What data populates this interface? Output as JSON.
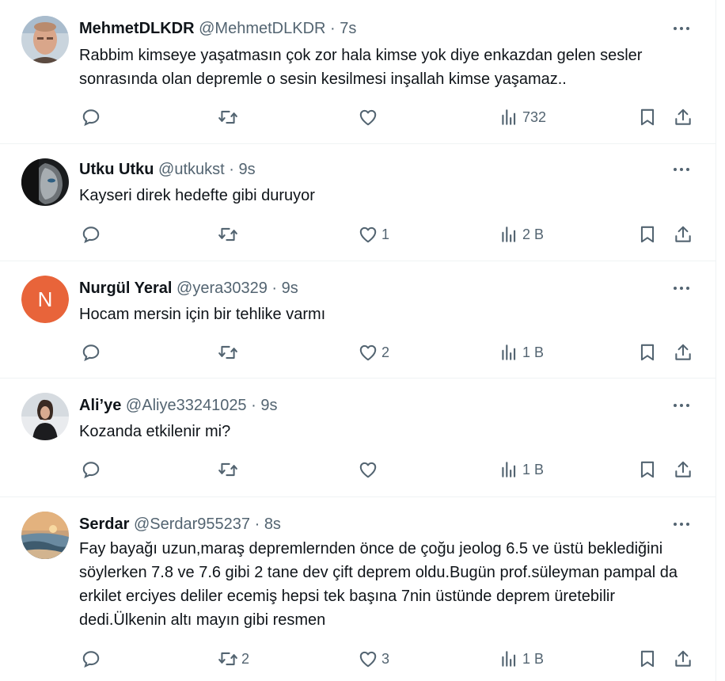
{
  "tweets": [
    {
      "name": "MehmetDLKDR",
      "handle": "@MehmetDLKDR",
      "time": "7s",
      "text": "Rabbim kimseye yaşatmasın çok zor hala kimse yok diye enkazdan gelen sesler sonrasında olan depremle o sesin kesilmesi inşallah kimse yaşamaz..",
      "replies": "",
      "retweets": "",
      "likes": "",
      "views": "732"
    },
    {
      "name": "Utku Utku",
      "handle": "@utkukst",
      "time": "9s",
      "text": "Kayseri direk hedefte gibi duruyor",
      "replies": "",
      "retweets": "",
      "likes": "1",
      "views": "2 B"
    },
    {
      "name": "Nurgül Yeral",
      "handle": "@yera30329",
      "time": "9s",
      "text": "Hocam mersin için bir tehlike varmı",
      "avatar_letter": "N",
      "avatar_color": "#e8643a",
      "replies": "",
      "retweets": "",
      "likes": "2",
      "views": "1 B"
    },
    {
      "name": "Ali’ye",
      "handle": "@Aliye33241025",
      "time": "9s",
      "text": "Kozanda etkilenir mi?",
      "replies": "",
      "retweets": "",
      "likes": "",
      "views": "1 B"
    },
    {
      "name": "Serdar",
      "handle": "@Serdar955237",
      "time": "8s",
      "text": "Fay bayağı uzun,maraş depremlernden önce de çoğu jeolog 6.5 ve üstü beklediğini söylerken 7.8 ve 7.6 gibi 2 tane dev çift deprem oldu.Bugün prof.süleyman pampal da erkilet erciyes deliler ecemiş hepsi tek başına 7nin üstünde deprem üretebilir dedi.Ülkenin altı mayın gibi resmen",
      "replies": "",
      "retweets": "2",
      "likes": "3",
      "views": "1 B"
    }
  ],
  "separator": "·",
  "icons": {
    "reply": "reply-icon",
    "retweet": "retweet-icon",
    "like": "heart-icon",
    "views": "views-icon",
    "bookmark": "bookmark-icon",
    "share": "share-icon",
    "more": "more-icon"
  },
  "colors": {
    "text": "#0f1419",
    "secondary": "#536471",
    "border": "#eff3f4"
  }
}
